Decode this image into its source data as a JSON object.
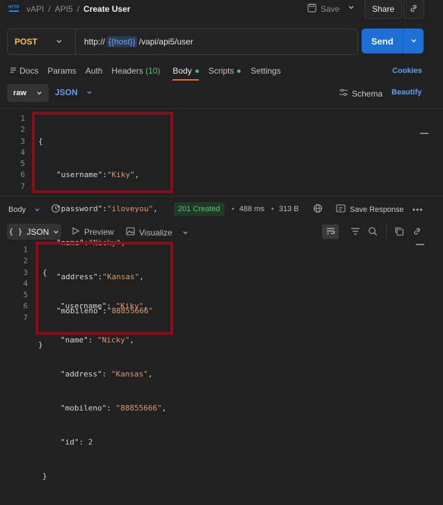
{
  "breadcrumb": {
    "workspace": "vAPI",
    "folder": "API5",
    "current": "Create User",
    "sep": "/"
  },
  "header": {
    "save_label": "Save",
    "share_label": "Share"
  },
  "request": {
    "method": "POST",
    "url_prefix": "http://",
    "url_var": "{{host}}",
    "url_path": "/vapi/api5/user",
    "send_label": "Send"
  },
  "tabs": {
    "docs": "Docs",
    "params": "Params",
    "auth": "Auth",
    "headers": "Headers",
    "headers_count": "(10)",
    "body": "Body",
    "scripts": "Scripts",
    "settings": "Settings",
    "cookies": "Cookies"
  },
  "body_options": {
    "mode": "raw",
    "format": "JSON",
    "schema": "Schema",
    "beautify": "Beautify"
  },
  "request_body": {
    "lines": [
      "1",
      "2",
      "3",
      "4",
      "5",
      "6",
      "7"
    ],
    "open": "{",
    "close": "}",
    "fields": [
      {
        "key": "\"username\"",
        "value": "\"Kiky\"",
        "trail": ","
      },
      {
        "key": "\"password\"",
        "value": "\"iloveyou\"",
        "trail": ","
      },
      {
        "key": "\"name\"",
        "value": "\"Nicky\"",
        "trail": ","
      },
      {
        "key": "\"address\"",
        "value": "\"Kansas\"",
        "trail": ","
      },
      {
        "key": "\"mobileno\"",
        "value": "\"88855666\"",
        "trail": ""
      }
    ]
  },
  "response": {
    "body_label": "Body",
    "status": "201 Created",
    "time": "488 ms",
    "size": "313 B",
    "save_response": "Save Response",
    "view_format": "JSON",
    "preview": "Preview",
    "visualize": "Visualize"
  },
  "response_body": {
    "lines": [
      "1",
      "2",
      "3",
      "4",
      "5",
      "6",
      "7"
    ],
    "open": "{",
    "close": "}",
    "fields": [
      {
        "key": "\"username\"",
        "value": "\"Kiky\"",
        "trail": ","
      },
      {
        "key": "\"name\"",
        "value": "\"Nicky\"",
        "trail": ","
      },
      {
        "key": "\"address\"",
        "value": "\"Kansas\"",
        "trail": ","
      },
      {
        "key": "\"mobileno\"",
        "value": "\"88855666\"",
        "trail": ","
      },
      {
        "key": "\"id\"",
        "value": "2",
        "trail": ""
      }
    ]
  },
  "colors": {
    "accent": "#1f6fd1",
    "send": "#1e6fd6",
    "highlight_box": "#8b0d18",
    "status_green": "#5cbf7a",
    "method_yellow": "#f0c54a"
  }
}
